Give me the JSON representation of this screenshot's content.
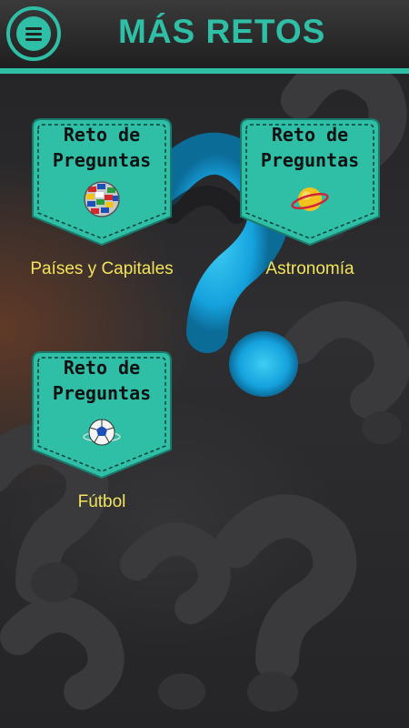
{
  "header": {
    "title": "MÁS RETOS",
    "menu_icon": "hamburger-menu-icon"
  },
  "colors": {
    "accent": "#2fbfa6",
    "caption": "#f2e35a",
    "badge_fill": "#2fbfa6"
  },
  "cards": [
    {
      "badge_line1": "Reto de",
      "badge_line2": "Preguntas",
      "icon": "world-flags-globe-icon",
      "caption": "Países y Capitales"
    },
    {
      "badge_line1": "Reto de",
      "badge_line2": "Preguntas",
      "icon": "saturn-planet-icon",
      "caption": "Astronomía"
    },
    {
      "badge_line1": "Reto de",
      "badge_line2": "Preguntas",
      "icon": "soccer-ball-icon",
      "caption": "Fútbol"
    }
  ]
}
